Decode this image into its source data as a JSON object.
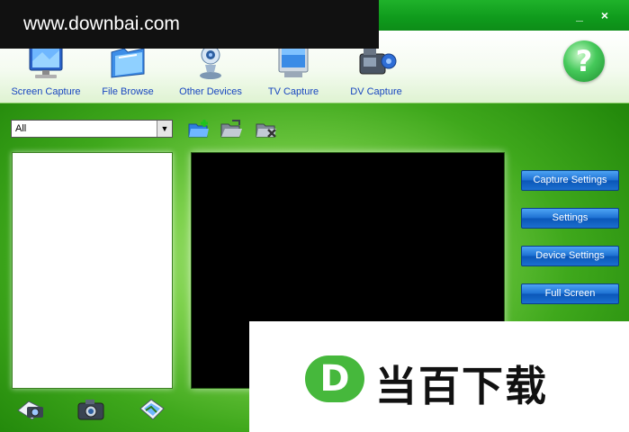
{
  "window": {
    "minimize_glyph": "_",
    "close_glyph": "×"
  },
  "watermark": {
    "url": "www.downbai.com",
    "logo_letter": "D",
    "brand": "当百下载"
  },
  "toolbar": {
    "items": [
      {
        "label": "Screen Capture",
        "icon": "monitor-icon"
      },
      {
        "label": "File Browse",
        "icon": "folder-icon"
      },
      {
        "label": "Other Devices",
        "icon": "webcam-icon"
      },
      {
        "label": "TV Capture",
        "icon": "tv-icon"
      },
      {
        "label": "DV Capture",
        "icon": "camcorder-icon"
      }
    ],
    "help_glyph": "?"
  },
  "filter": {
    "selected": "All",
    "arrow": "▼"
  },
  "folder_actions": [
    "new-folder-icon",
    "open-folder-icon",
    "delete-folder-icon"
  ],
  "side_buttons": {
    "capture_settings": "Capture Settings",
    "settings": "Settings",
    "device_settings": "Device Settings",
    "full_screen": "Full Screen"
  },
  "bottom_actions": [
    "snapshot-left-icon",
    "camera-icon",
    "snapshot-right-icon"
  ],
  "colors": {
    "accent_green": "#2a8a12",
    "button_blue": "#1c6fd1",
    "label_blue": "#1846c0"
  }
}
